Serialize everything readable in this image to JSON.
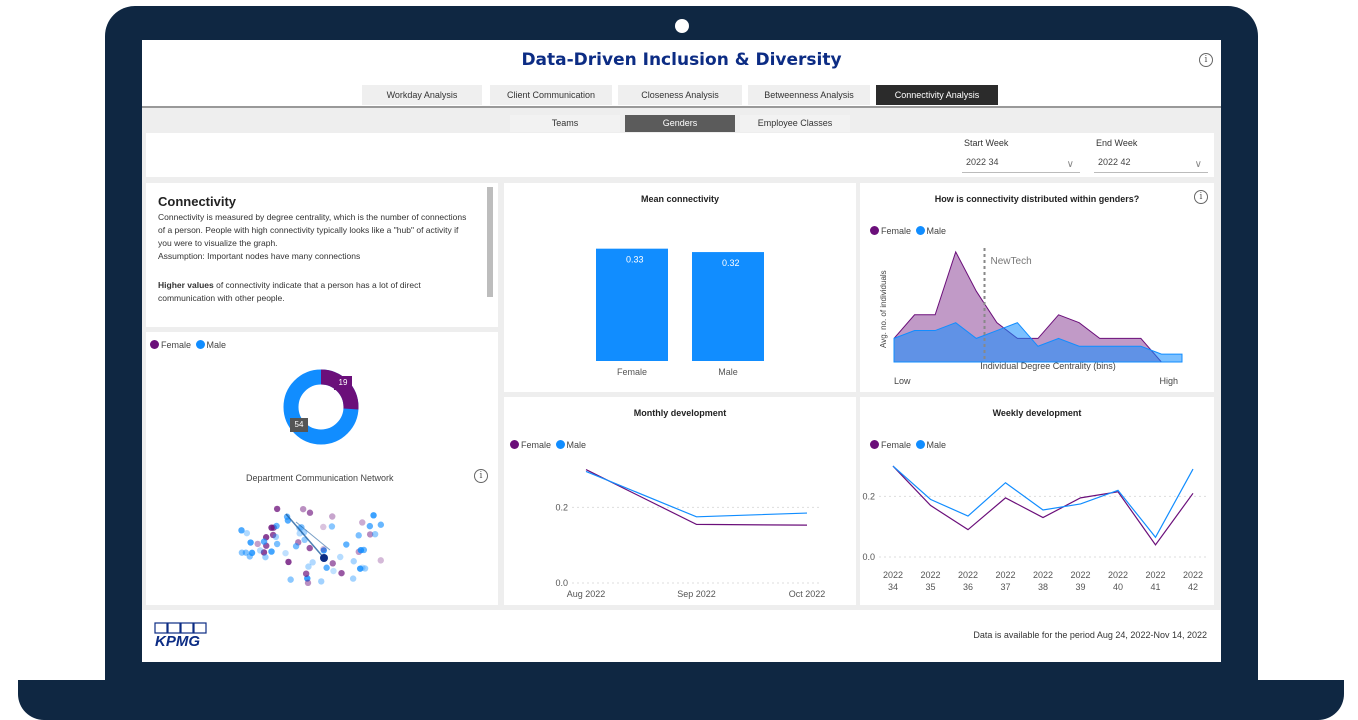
{
  "header": {
    "title": "Data-Driven Inclusion & Diversity",
    "info_glyph": "i"
  },
  "tabs": [
    {
      "label": "Workday Analysis"
    },
    {
      "label": "Client Communication"
    },
    {
      "label": "Closeness Analysis"
    },
    {
      "label": "Betweenness Analysis"
    },
    {
      "label": "Connectivity Analysis",
      "active": true
    }
  ],
  "subtabs": [
    {
      "label": "Teams"
    },
    {
      "label": "Genders",
      "active": true
    },
    {
      "label": "Employee Classes"
    }
  ],
  "filters": {
    "start_label": "Start Week",
    "start_value": "2022 34",
    "end_label": "End Week",
    "end_value": "2022 42",
    "chevron": "∨"
  },
  "description": {
    "title": "Connectivity",
    "lines": [
      "Connectivity is measured by degree centrality, which is the number of connections",
      "of a person. People with high connectivity typically looks like a \"hub\" of activity if",
      "you were to visualize the graph.",
      "Assumption:    Important nodes have many connections"
    ],
    "bold_lead": "Higher values",
    "bold_rest": " of connectivity indicate that a person has a lot of direct",
    "last_line": "communication with other people."
  },
  "legend": {
    "female": "Female",
    "male": "Male"
  },
  "colors": {
    "female": "#6b0f7a",
    "male": "#118dff",
    "navy": "#0c2c84",
    "frame": "#0f2742"
  },
  "donut": {
    "female_label": "19",
    "male_label": "54"
  },
  "network": {
    "title": "Department Communication Network"
  },
  "footer": {
    "logo": "KPMG",
    "note": "Data is available for the period Aug 24, 2022-Nov 14, 2022"
  },
  "chart_data": [
    {
      "type": "bar",
      "title": "Mean connectivity",
      "categories": [
        "Female",
        "Male"
      ],
      "values": [
        0.33,
        0.32
      ],
      "value_labels": [
        "0.33",
        "0.32"
      ],
      "ylim": [
        0,
        0.4
      ]
    },
    {
      "type": "area",
      "title": "How is connectivity distributed within genders?",
      "xlabel": "Individual Degree Centrality (bins)",
      "ylabel": "Avg. no. of individuals",
      "x_start_label": "Low",
      "x_end_label": "High",
      "annotation": "NewTech",
      "annotation_bin": 4.4,
      "series": [
        {
          "name": "Female",
          "values": [
            3,
            6,
            6,
            14,
            9,
            5,
            3,
            3,
            6,
            5,
            3,
            3,
            3,
            0
          ]
        },
        {
          "name": "Male",
          "values": [
            3,
            4,
            4,
            5,
            3,
            4,
            5,
            2,
            3,
            2,
            2,
            2,
            2,
            1,
            1
          ]
        }
      ],
      "ylim": [
        0,
        15
      ]
    },
    {
      "type": "line",
      "title": "Monthly development",
      "categories": [
        "Aug 2022",
        "Sep 2022",
        "Oct 2022"
      ],
      "y_ticks": [
        "0.0",
        "0.2"
      ],
      "ylim": [
        0,
        0.32
      ],
      "series": [
        {
          "name": "Female",
          "values": [
            0.3,
            0.155,
            0.153
          ]
        },
        {
          "name": "Male",
          "values": [
            0.295,
            0.175,
            0.185
          ]
        }
      ]
    },
    {
      "type": "line",
      "title": "Weekly development",
      "categories": [
        [
          "2022",
          "34"
        ],
        [
          "2022",
          "35"
        ],
        [
          "2022",
          "36"
        ],
        [
          "2022",
          "37"
        ],
        [
          "2022",
          "38"
        ],
        [
          "2022",
          "39"
        ],
        [
          "2022",
          "40"
        ],
        [
          "2022",
          "41"
        ],
        [
          "2022",
          "42"
        ]
      ],
      "y_ticks": [
        "0.0",
        "0.2"
      ],
      "ylim": [
        -0.02,
        0.32
      ],
      "series": [
        {
          "name": "Female",
          "values": [
            0.3,
            0.17,
            0.09,
            0.195,
            0.13,
            0.195,
            0.215,
            0.04,
            0.21
          ]
        },
        {
          "name": "Male",
          "values": [
            0.3,
            0.19,
            0.135,
            0.245,
            0.155,
            0.175,
            0.22,
            0.065,
            0.29
          ]
        }
      ]
    }
  ]
}
